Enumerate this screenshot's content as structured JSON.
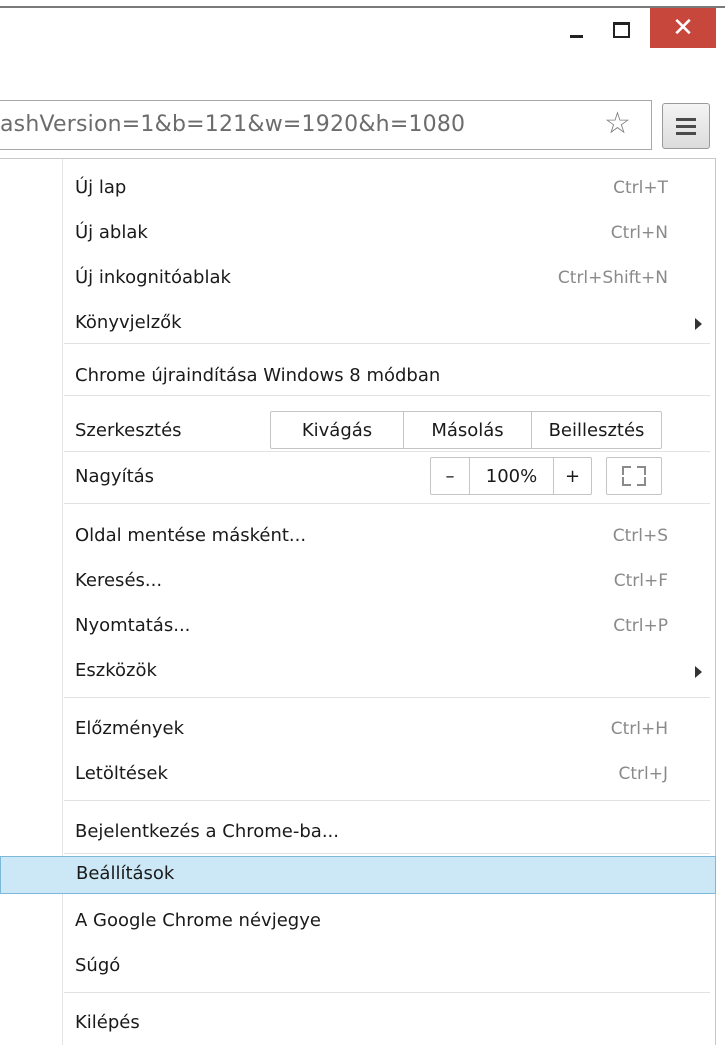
{
  "window": {
    "minimize_icon": "minimize-icon",
    "maximize_icon": "maximize-icon",
    "close_label": "✕"
  },
  "omnibox": {
    "url": "ashVersion=1&b=121&w=1920&h=1080",
    "star_glyph": "☆"
  },
  "menu": {
    "items": [
      {
        "label": "Új lap",
        "shortcut": "Ctrl+T"
      },
      {
        "label": "Új ablak",
        "shortcut": "Ctrl+N"
      },
      {
        "label": "Új inkognitóablak",
        "shortcut": "Ctrl+Shift+N"
      },
      {
        "label": "Könyvjelzők",
        "submenu": true
      },
      {
        "label": "Chrome újraindítása Windows 8 módban"
      },
      {
        "label": "Szerkesztés",
        "buttons": [
          "Kivágás",
          "Másolás",
          "Beillesztés"
        ]
      },
      {
        "label": "Nagyítás",
        "zoom_minus": "–",
        "zoom_value": "100%",
        "zoom_plus": "+"
      },
      {
        "label": "Oldal mentése másként...",
        "shortcut": "Ctrl+S"
      },
      {
        "label": "Keresés...",
        "shortcut": "Ctrl+F"
      },
      {
        "label": "Nyomtatás...",
        "shortcut": "Ctrl+P"
      },
      {
        "label": "Eszközök",
        "submenu": true
      },
      {
        "label": "Előzmények",
        "shortcut": "Ctrl+H"
      },
      {
        "label": "Letöltések",
        "shortcut": "Ctrl+J"
      },
      {
        "label": "Bejelentkezés a Chrome-ba..."
      },
      {
        "label": "Beállítások",
        "highlighted": true
      },
      {
        "label": "A Google Chrome névjegye"
      },
      {
        "label": "Súgó"
      },
      {
        "label": "Kilépés"
      }
    ]
  },
  "colors": {
    "highlight": "#cce8f7",
    "highlight_border": "#7bb8da",
    "close_button": "#c8473d"
  }
}
